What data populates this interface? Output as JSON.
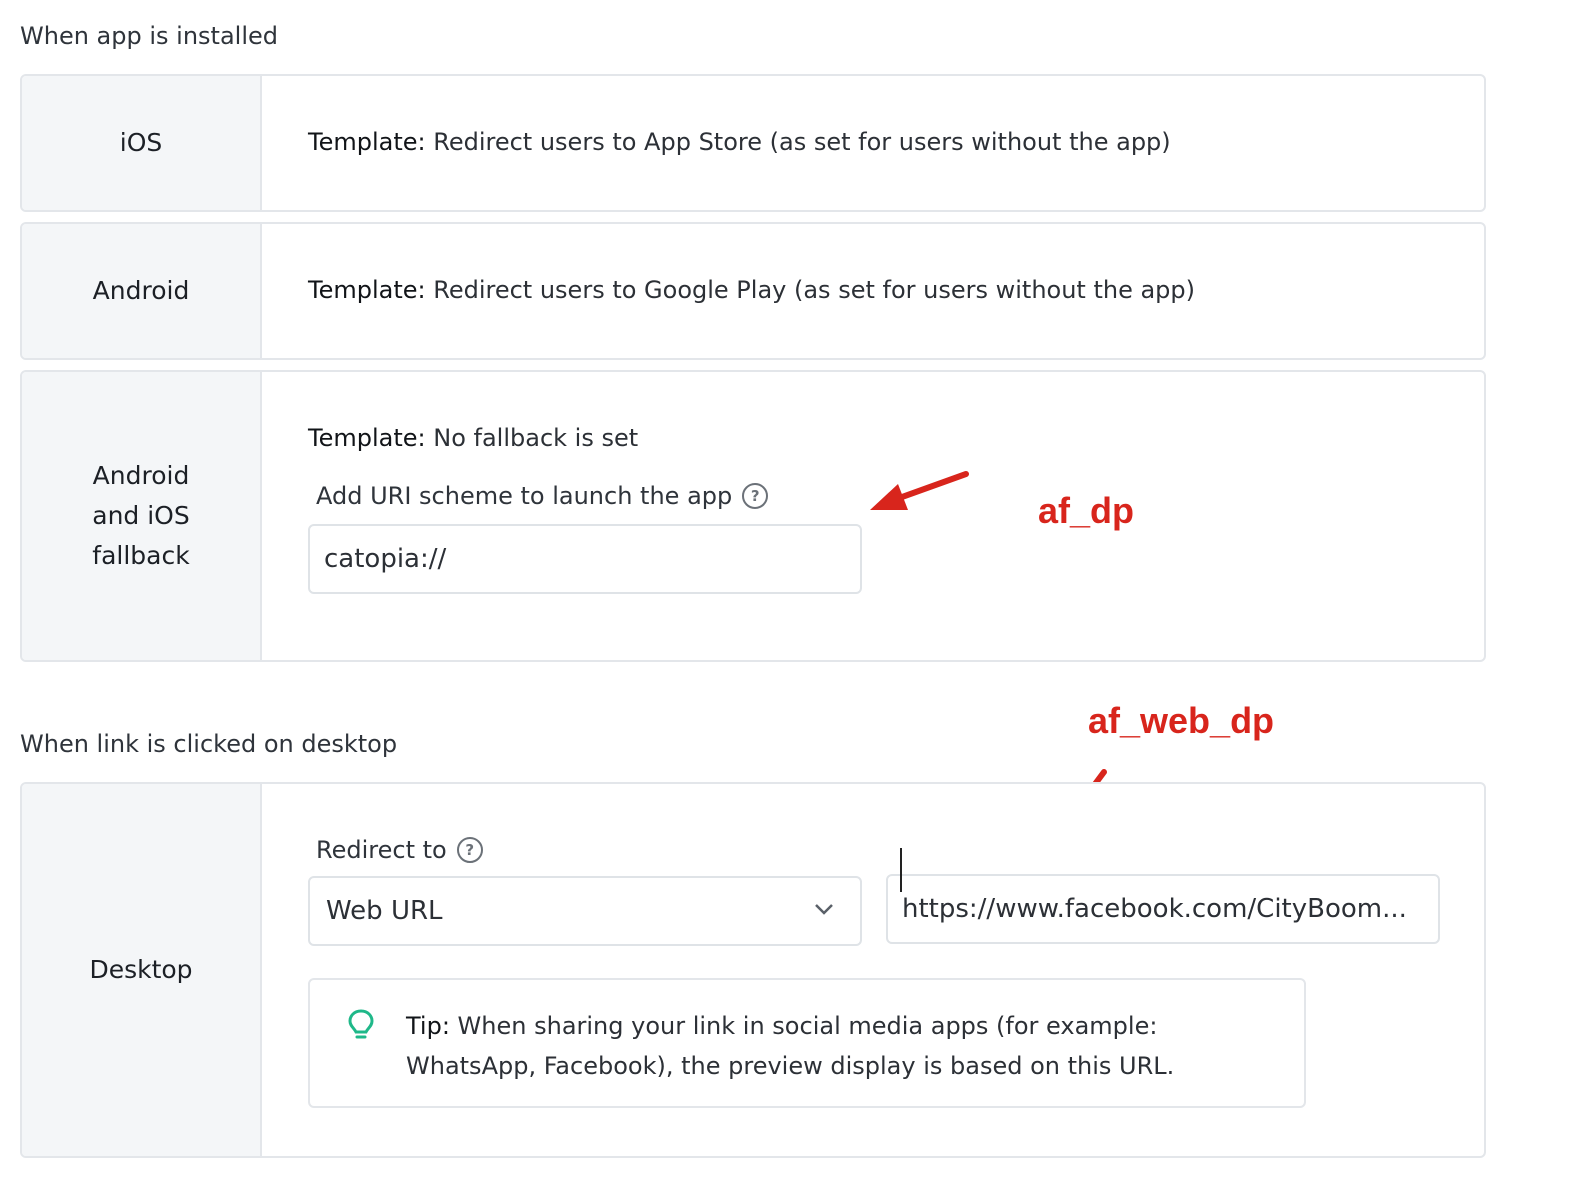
{
  "installed_section": {
    "title": "When app is installed"
  },
  "rows": {
    "ios": {
      "label": "iOS",
      "template_prefix": "Template:",
      "template_text": " Redirect users to App Store (as set for users without the app)"
    },
    "android": {
      "label": "Android",
      "template_prefix": "Template:",
      "template_text": " Redirect users to Google Play (as set for users without the app)"
    },
    "fallback": {
      "label_lines": [
        "Android",
        "and iOS",
        "fallback"
      ],
      "template_prefix": "Template:",
      "template_text": " No fallback is set",
      "uri_label": "Add URI scheme to launch the app",
      "uri_value": "catopia://"
    }
  },
  "desktop_section": {
    "title": "When link is clicked on desktop"
  },
  "desktop": {
    "label": "Desktop",
    "redirect_label": "Redirect to",
    "redirect_selected": "Web URL",
    "url_value": "https://www.facebook.com/CityBoom...",
    "tip_prefix": "Tip:",
    "tip_text": " When sharing your link in social media apps (for example: WhatsApp, Facebook), the preview display is based on this URL."
  },
  "annotations": {
    "af_dp": "af_dp",
    "af_web_dp": "af_web_dp",
    "color": "#d8251c"
  },
  "icons": {
    "help": "question-circle-icon",
    "chevron": "chevron-down-icon",
    "tip": "lightbulb-icon"
  },
  "colors": {
    "tip_icon": "#1fb889",
    "label_bg": "#f4f6f8",
    "border": "#e3e6ea"
  }
}
